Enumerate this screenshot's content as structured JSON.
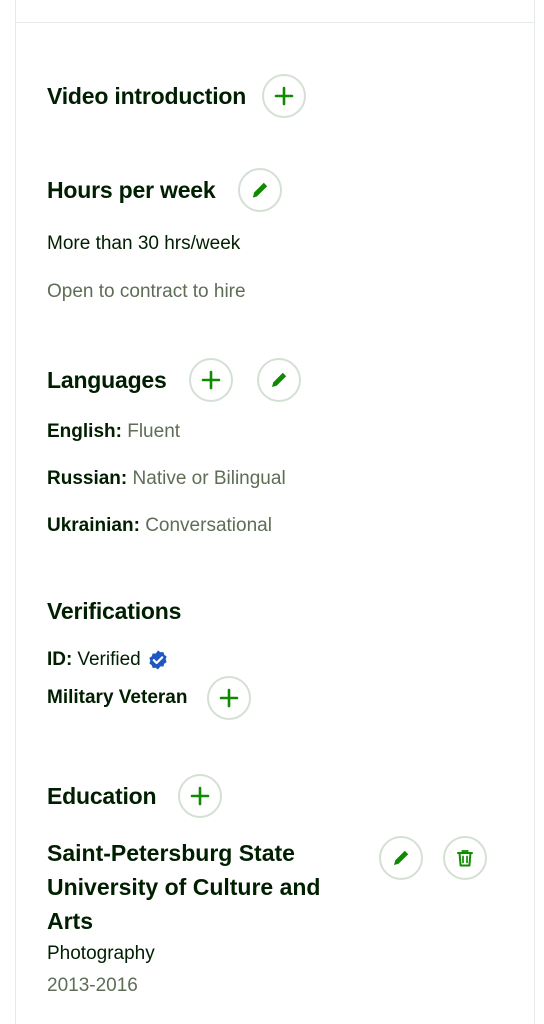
{
  "video_introduction": {
    "title": "Video introduction"
  },
  "hours_per_week": {
    "title": "Hours per week",
    "value": "More than 30 hrs/week",
    "note": "Open to contract to hire"
  },
  "languages": {
    "title": "Languages",
    "items": [
      {
        "name": "English:",
        "level": "Fluent"
      },
      {
        "name": "Russian:",
        "level": "Native or Bilingual"
      },
      {
        "name": "Ukrainian:",
        "level": "Conversational"
      }
    ]
  },
  "verifications": {
    "title": "Verifications",
    "id_label": "ID:",
    "id_value": "Verified",
    "military_label": "Military Veteran"
  },
  "education": {
    "title": "Education",
    "school": "Saint-Petersburg State University of Culture and Arts",
    "field": "Photography",
    "years": "2013-2016"
  },
  "icons": {
    "add": "plus-icon",
    "edit": "pencil-icon",
    "delete": "trash-icon",
    "verified": "verified-badge-icon"
  },
  "colors": {
    "accent_green": "#108a00",
    "text": "#001e00",
    "muted": "#5e6d55",
    "verified_blue": "#1f57c3"
  }
}
